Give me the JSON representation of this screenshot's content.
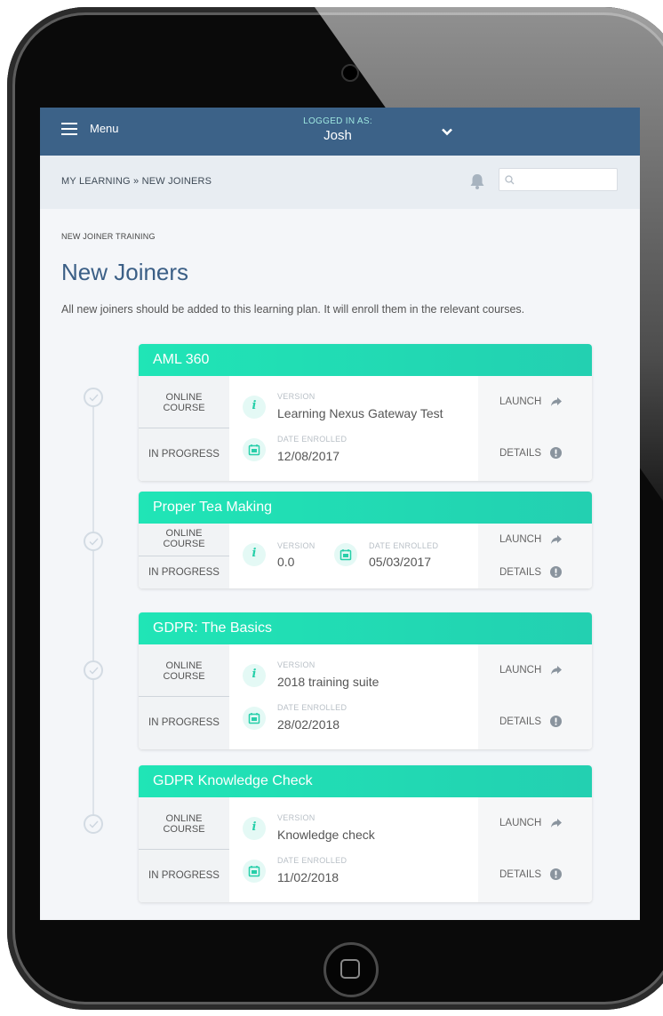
{
  "topbar": {
    "menu_label": "Menu",
    "login_caption": "LOGGED IN AS:",
    "username": "Josh"
  },
  "breadcrumb": "MY LEARNING » NEW JOINERS",
  "search": {
    "placeholder": ""
  },
  "plan": {
    "caption": "NEW JOINER TRAINING",
    "title": "New Joiners",
    "description": "All new joiners should be added to this learning plan. It will enroll them in the relevant courses."
  },
  "labels": {
    "version": "VERSION",
    "date_enrolled": "DATE ENROLLED",
    "launch": "LAUNCH",
    "details": "DETAILS",
    "type_line1": "ONLINE",
    "type_line2": "COURSE",
    "status": "IN PROGRESS"
  },
  "courses": [
    {
      "title": "AML 360",
      "version": "Learning Nexus Gateway Test",
      "date": "12/08/2017"
    },
    {
      "title": "Proper Tea Making",
      "version": "0.0",
      "date": "05/03/2017"
    },
    {
      "title": "GDPR: The Basics",
      "version": "2018 training suite",
      "date": "28/02/2018"
    },
    {
      "title": "GDPR Knowledge Check",
      "version": "Knowledge check",
      "date": "11/02/2018"
    }
  ],
  "colors": {
    "topbar": "#3c6288",
    "accent_green": "#20e5b6",
    "title_blue": "#3b5f86"
  },
  "icons": [
    "hamburger-icon",
    "chevron-down-icon",
    "bell-icon",
    "search-icon",
    "info-icon",
    "calendar-icon",
    "share-arrow-icon",
    "exclamation-circle-icon",
    "check-circle-icon"
  ]
}
